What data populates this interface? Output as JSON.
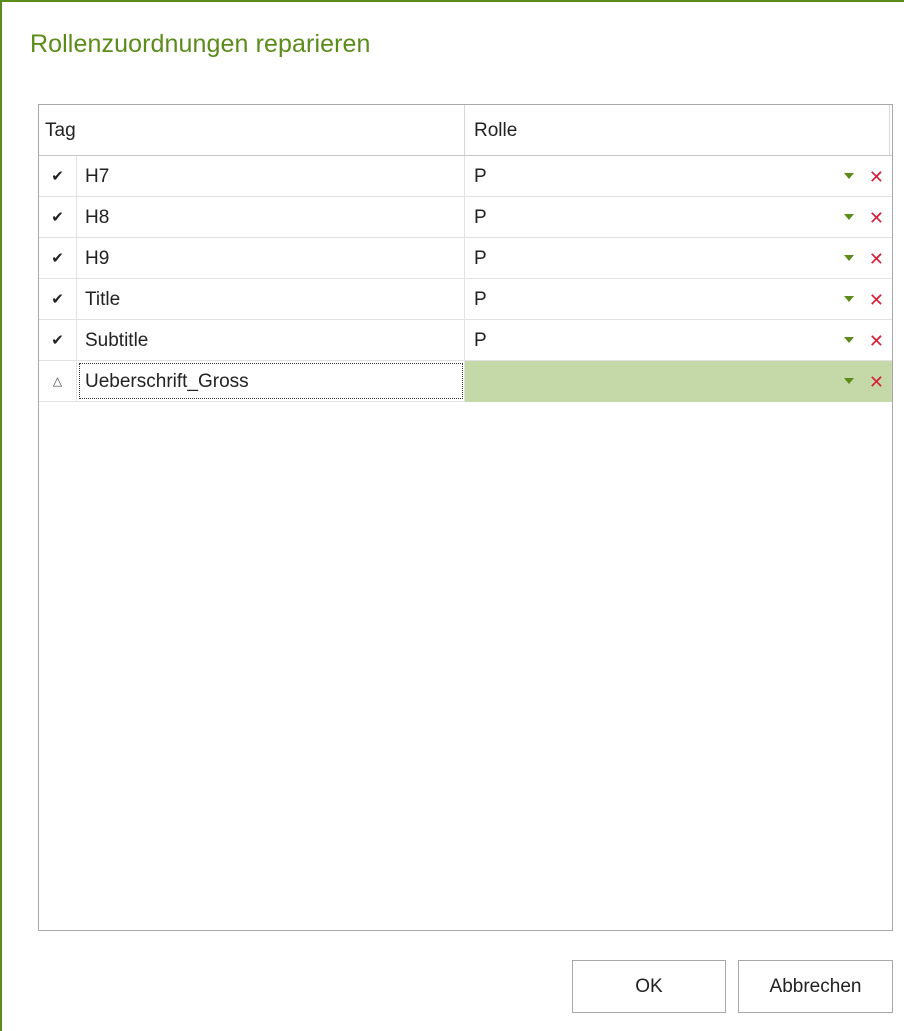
{
  "dialog": {
    "title": "Rollenzuordnungen reparieren"
  },
  "grid": {
    "columns": {
      "tag": "Tag",
      "rolle": "Rolle"
    },
    "rows": [
      {
        "status": "check-icon",
        "status_glyph": "✔",
        "tag": "H7",
        "rolle": "P"
      },
      {
        "status": "check-icon",
        "status_glyph": "✔",
        "tag": "H8",
        "rolle": "P"
      },
      {
        "status": "check-icon",
        "status_glyph": "✔",
        "tag": "H9",
        "rolle": "P"
      },
      {
        "status": "check-icon",
        "status_glyph": "✔",
        "tag": "Title",
        "rolle": "P"
      },
      {
        "status": "check-icon",
        "status_glyph": "✔",
        "tag": "Subtitle",
        "rolle": "P"
      },
      {
        "status": "warning-icon",
        "status_glyph": "△",
        "tag": "Ueberschrift_Gross",
        "rolle": ""
      }
    ]
  },
  "buttons": {
    "ok": "OK",
    "cancel": "Abbrechen"
  },
  "colors": {
    "accent": "#5b8c1a",
    "selected_row": "#c5d9a8",
    "remove": "#d61f3a"
  }
}
